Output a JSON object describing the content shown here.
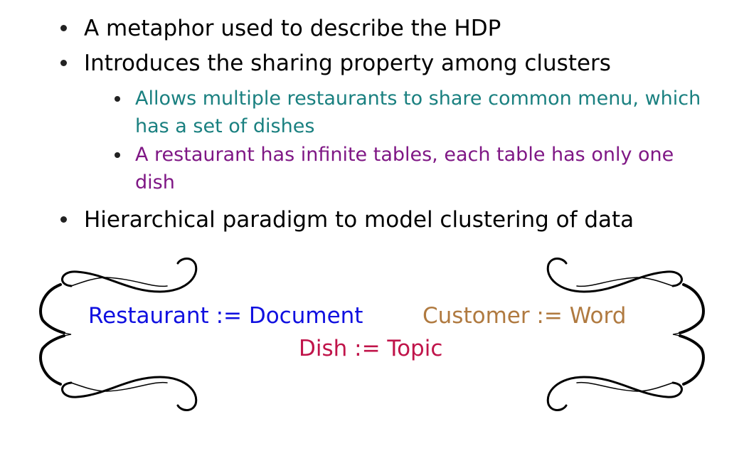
{
  "bullets": [
    {
      "text": "A metaphor used to describe the HDP"
    },
    {
      "text": "Introduces the sharing property among clusters",
      "sub": [
        {
          "text": "Allows multiple restaurants to share common menu, which has a set of dishes",
          "color": "#1a8080"
        },
        {
          "text": "A restaurant has infinite tables, each table has only one dish",
          "color": "#7f1785"
        }
      ]
    },
    {
      "text": "Hierarchical paradigm to model clustering of data"
    }
  ],
  "definitions": {
    "restaurant": "Restaurant := Document",
    "customer": "Customer := Word",
    "dish": "Dish := Topic"
  },
  "colors": {
    "restaurant": "#1010e0",
    "customer": "#b07a40",
    "dish": "#c0144a",
    "sub_teal": "#1a8080",
    "sub_purple": "#7f1785"
  }
}
